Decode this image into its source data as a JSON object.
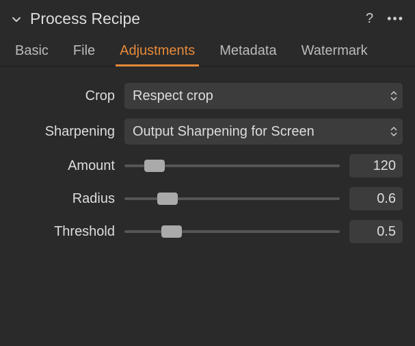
{
  "header": {
    "title": "Process Recipe"
  },
  "tabs": [
    {
      "label": "Basic",
      "active": false
    },
    {
      "label": "File",
      "active": false
    },
    {
      "label": "Adjustments",
      "active": true
    },
    {
      "label": "Metadata",
      "active": false
    },
    {
      "label": "Watermark",
      "active": false
    }
  ],
  "controls": {
    "crop": {
      "label": "Crop",
      "value": "Respect crop"
    },
    "sharpening": {
      "label": "Sharpening",
      "value": "Output Sharpening for Screen"
    },
    "amount": {
      "label": "Amount",
      "value": "120",
      "percent": 14
    },
    "radius": {
      "label": "Radius",
      "value": "0.6",
      "percent": 20
    },
    "threshold": {
      "label": "Threshold",
      "value": "0.5",
      "percent": 22
    }
  }
}
